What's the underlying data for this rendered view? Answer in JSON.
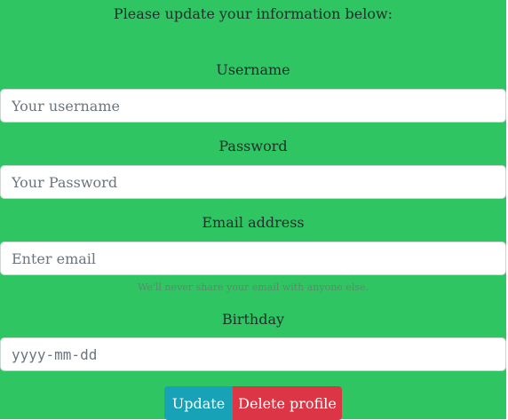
{
  "form": {
    "intro": "Please update your information below:",
    "username": {
      "label": "Username",
      "placeholder": "Your username",
      "value": ""
    },
    "password": {
      "label": "Password",
      "placeholder": "Your Password",
      "value": ""
    },
    "email": {
      "label": "Email address",
      "placeholder": "Enter email",
      "value": "",
      "help": "We'll never share your email with anyone else."
    },
    "birthday": {
      "label": "Birthday",
      "placeholder": "yyyy-mm-dd",
      "value": ""
    },
    "buttons": {
      "update": "Update",
      "delete": "Delete profile"
    }
  },
  "colors": {
    "panel_background": "#2ec562",
    "update_button": "#17a2b8",
    "delete_button": "#dc3545",
    "text": "#21302a"
  }
}
